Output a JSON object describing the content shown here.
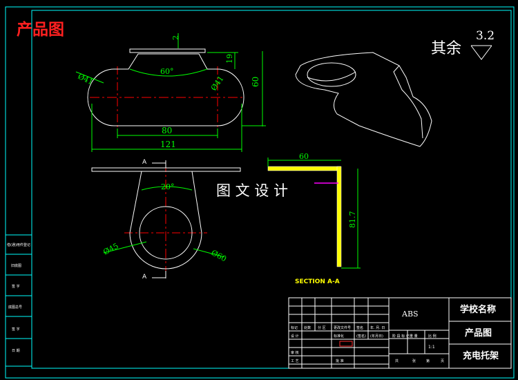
{
  "header": {
    "title": "产品图"
  },
  "roughness": {
    "label": "其余",
    "value": "3.2"
  },
  "dimensions": {
    "thickness": "2",
    "height_19": "19",
    "angle_top": "60°",
    "radius_left": "Ø41",
    "radius_right": "Ø41",
    "height_60": "60",
    "center_distance": "80",
    "overall_width": "121",
    "angle_front": "20°",
    "hole_dia": "Ø45",
    "outer_dia": "Ø60",
    "section_width": "60",
    "section_height": "81.7"
  },
  "section": {
    "marker": "A",
    "label": "SECTION A-A"
  },
  "watermark": "图 文 设 计",
  "title_block": {
    "material": "ABS",
    "school": "学校名称",
    "drawing_name": "产品图",
    "part_name": "充电托架",
    "scale": "1:1",
    "row_labels": [
      "标记",
      "处数",
      "分 区",
      "更改文件号",
      "签名",
      "年. 月. 日"
    ],
    "sign_labels": [
      "设 计",
      "标准化",
      "(签名)",
      "(年月日)"
    ],
    "stage_labels": [
      "阶 段 标 记",
      "重 量",
      "比 例"
    ],
    "bottom_labels": [
      "审 核",
      "工 艺",
      "批 准",
      "共",
      "张",
      "第",
      "页"
    ]
  },
  "side_block": {
    "labels": [
      "借(通)用件登记",
      "旧底图",
      "签 字",
      "底图总号",
      "签 字",
      "日 期"
    ]
  },
  "colors": {
    "background": "#000000",
    "frame": "#00ffff",
    "outline": "#ffffff",
    "centerline": "#ff0000",
    "dimension": "#00ff00",
    "title_red": "#ff2020",
    "section_yellow": "#ffff00",
    "arrow_magenta": "#ff00ff"
  }
}
